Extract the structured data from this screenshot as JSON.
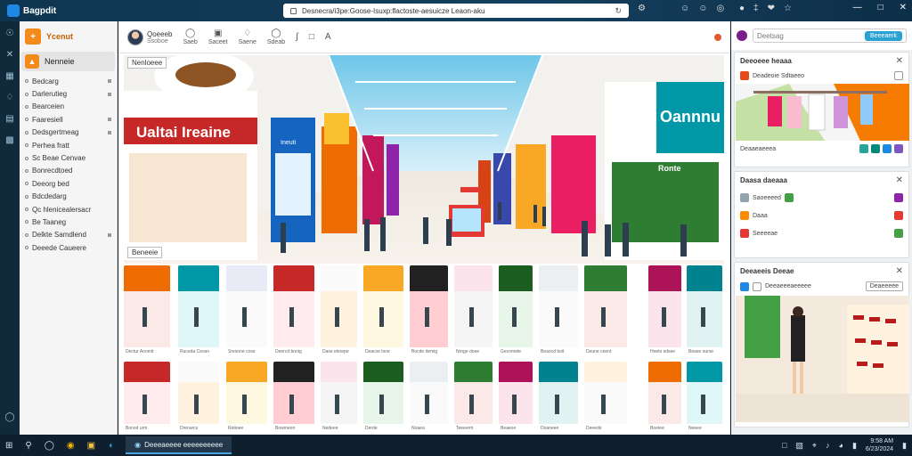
{
  "window": {
    "app_title": "Bagpdit",
    "url": "Desnecra/i3pe:Goose-Isuxp:flactoste-aesuicze Leaon-aku",
    "icons": [
      "chrome-icon",
      "settings-icon",
      "avatar-icon",
      "avatar-icon",
      "globe-icon",
      "pin-icon",
      "shield-icon",
      "heart-icon",
      "minimize-icon",
      "maximize-icon",
      "close-icon"
    ]
  },
  "sidebar": {
    "header": "Ycenut",
    "active_item": "Nenneie",
    "items": [
      "Bedcarg",
      "Darlerutieg",
      "Bearceien",
      "Faaresiell",
      "Dedsgertmeag",
      "Perhea fratt",
      "Sc Beae Cenvae",
      "Bonrecdtoed",
      "Deeorg bed",
      "Bdcdedarg",
      "Qc hlenicealersacr",
      "Be Taaneg",
      "Delkte Samdlend",
      "Deeede Caueere"
    ]
  },
  "toolbar": {
    "user_name": "Qoeeeb",
    "user_sub": "Ssoboe",
    "tools": [
      {
        "icon": "chat-icon",
        "label": "Saeb"
      },
      {
        "icon": "image-icon",
        "label": "Saceet"
      },
      {
        "icon": "tag-icon",
        "label": "Saene"
      },
      {
        "icon": "link-icon",
        "label": "Sdeab"
      },
      {
        "icon": "brush-icon",
        "label": ""
      },
      {
        "icon": "shape-icon",
        "label": ""
      },
      {
        "icon": "text-icon",
        "label": ""
      }
    ]
  },
  "hero": {
    "label": "Nenloeee",
    "caption": "Beneeie",
    "signs": [
      "Ualtai Ireaine",
      "Oannnu",
      "Ineuti",
      "Ronte"
    ]
  },
  "thumbnails": {
    "row1_captions": [
      "Dectur Aoomit",
      "Ruceda Ceosn",
      "Sresone cose",
      "Deercd bonig",
      "Dase eleorpe",
      "Deacve lone",
      "Bocde demig",
      "Nroge doee",
      "Gecomete",
      "Beaocd boit",
      "Deune ceent",
      "Heeto sdsee",
      "Bease ourse"
    ],
    "row2_captions": [
      "Bonod urm",
      "Drenarcs",
      "Retioee",
      "Bowmeon",
      "Nedeee",
      "Derde",
      "Noaea",
      "Teeeerm",
      "Beaeoe",
      "Doaneee",
      "Deeede",
      "Boetee",
      "Neeee"
    ]
  },
  "rightpanel": {
    "search_placeholder": "Deetsag",
    "search_button": "Beeeaerk",
    "card1": {
      "title": "Deeoeee heaaa",
      "row": "Deadeoie Sdtaeeo",
      "sub": "Deaaeaeeea"
    },
    "card2": {
      "title": "Daasa daeaaa",
      "rows": [
        "Saoeeeed",
        "Daaa",
        "Seeeeae"
      ]
    },
    "card3": {
      "title": "Deeaeeis Deeae",
      "row": "Deeaeeeaeeeee",
      "btn": "Deaeeeee"
    }
  },
  "taskbar": {
    "active_app": "Deeeaeeee eeeeeeeeee",
    "time": "9:58 AM",
    "date": "6/23/2024"
  }
}
